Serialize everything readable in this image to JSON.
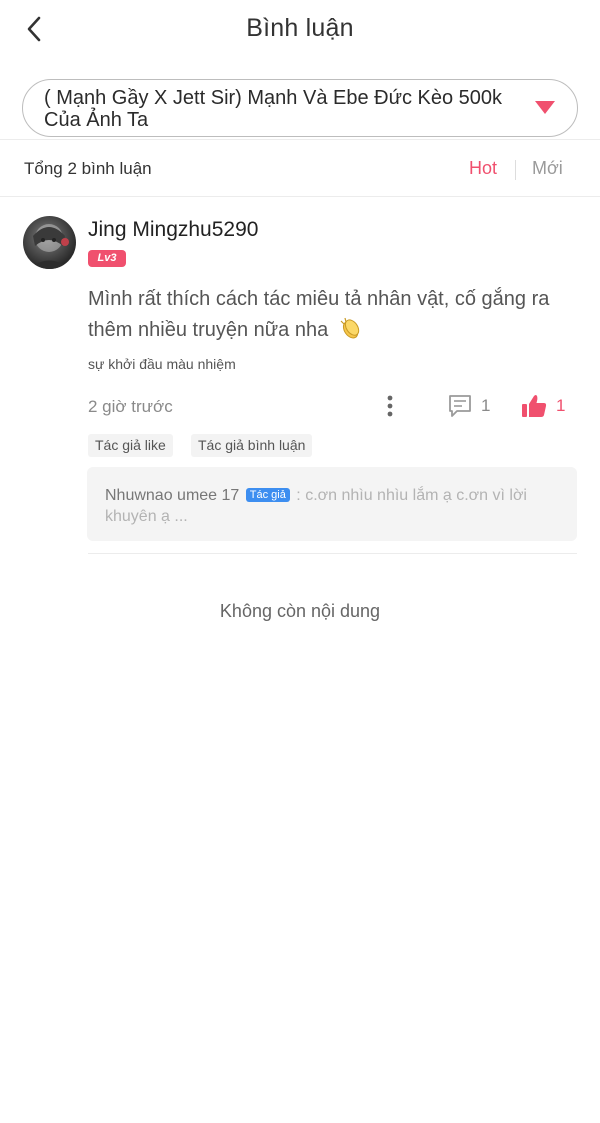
{
  "header": {
    "title": "Bình luận"
  },
  "chapter_selector": {
    "text": "( Mạnh Gầy X Jett Sir) Mạnh Và Ebe Đức Kèo 500k Của Ảnh Ta"
  },
  "summary": {
    "total": "Tổng 2 bình luận",
    "tabs": [
      {
        "label": "Hot",
        "active": true
      },
      {
        "label": "Mới",
        "active": false
      }
    ]
  },
  "comments": [
    {
      "username": "Jing Mingzhu5290",
      "level": "Lv3",
      "body": "Mình rất thích cách tác miêu tả nhân vật, cố gắng ra thêm nhiều truyện nữa nha",
      "emoji_icon": "clapping-hands",
      "chapter_ref": "sự khởi đầu màu nhiệm",
      "timestamp": "2 giờ trước",
      "reply_count": "1",
      "like_count": "1",
      "tags": [
        "Tác giả like",
        "Tác giả bình luận"
      ],
      "reply": {
        "author": "Nhuwnao umee 17",
        "badge": "Tác giả",
        "text": ": c.ơn nhìu nhìu lắm ạ c.ơn vì lời khuyên ạ ..."
      }
    }
  ],
  "footer": {
    "end_text": "Không còn nội dung"
  },
  "colors": {
    "accent": "#f0506e",
    "author_badge": "#3d8ef0",
    "muted_text": "#8a8a8a"
  }
}
